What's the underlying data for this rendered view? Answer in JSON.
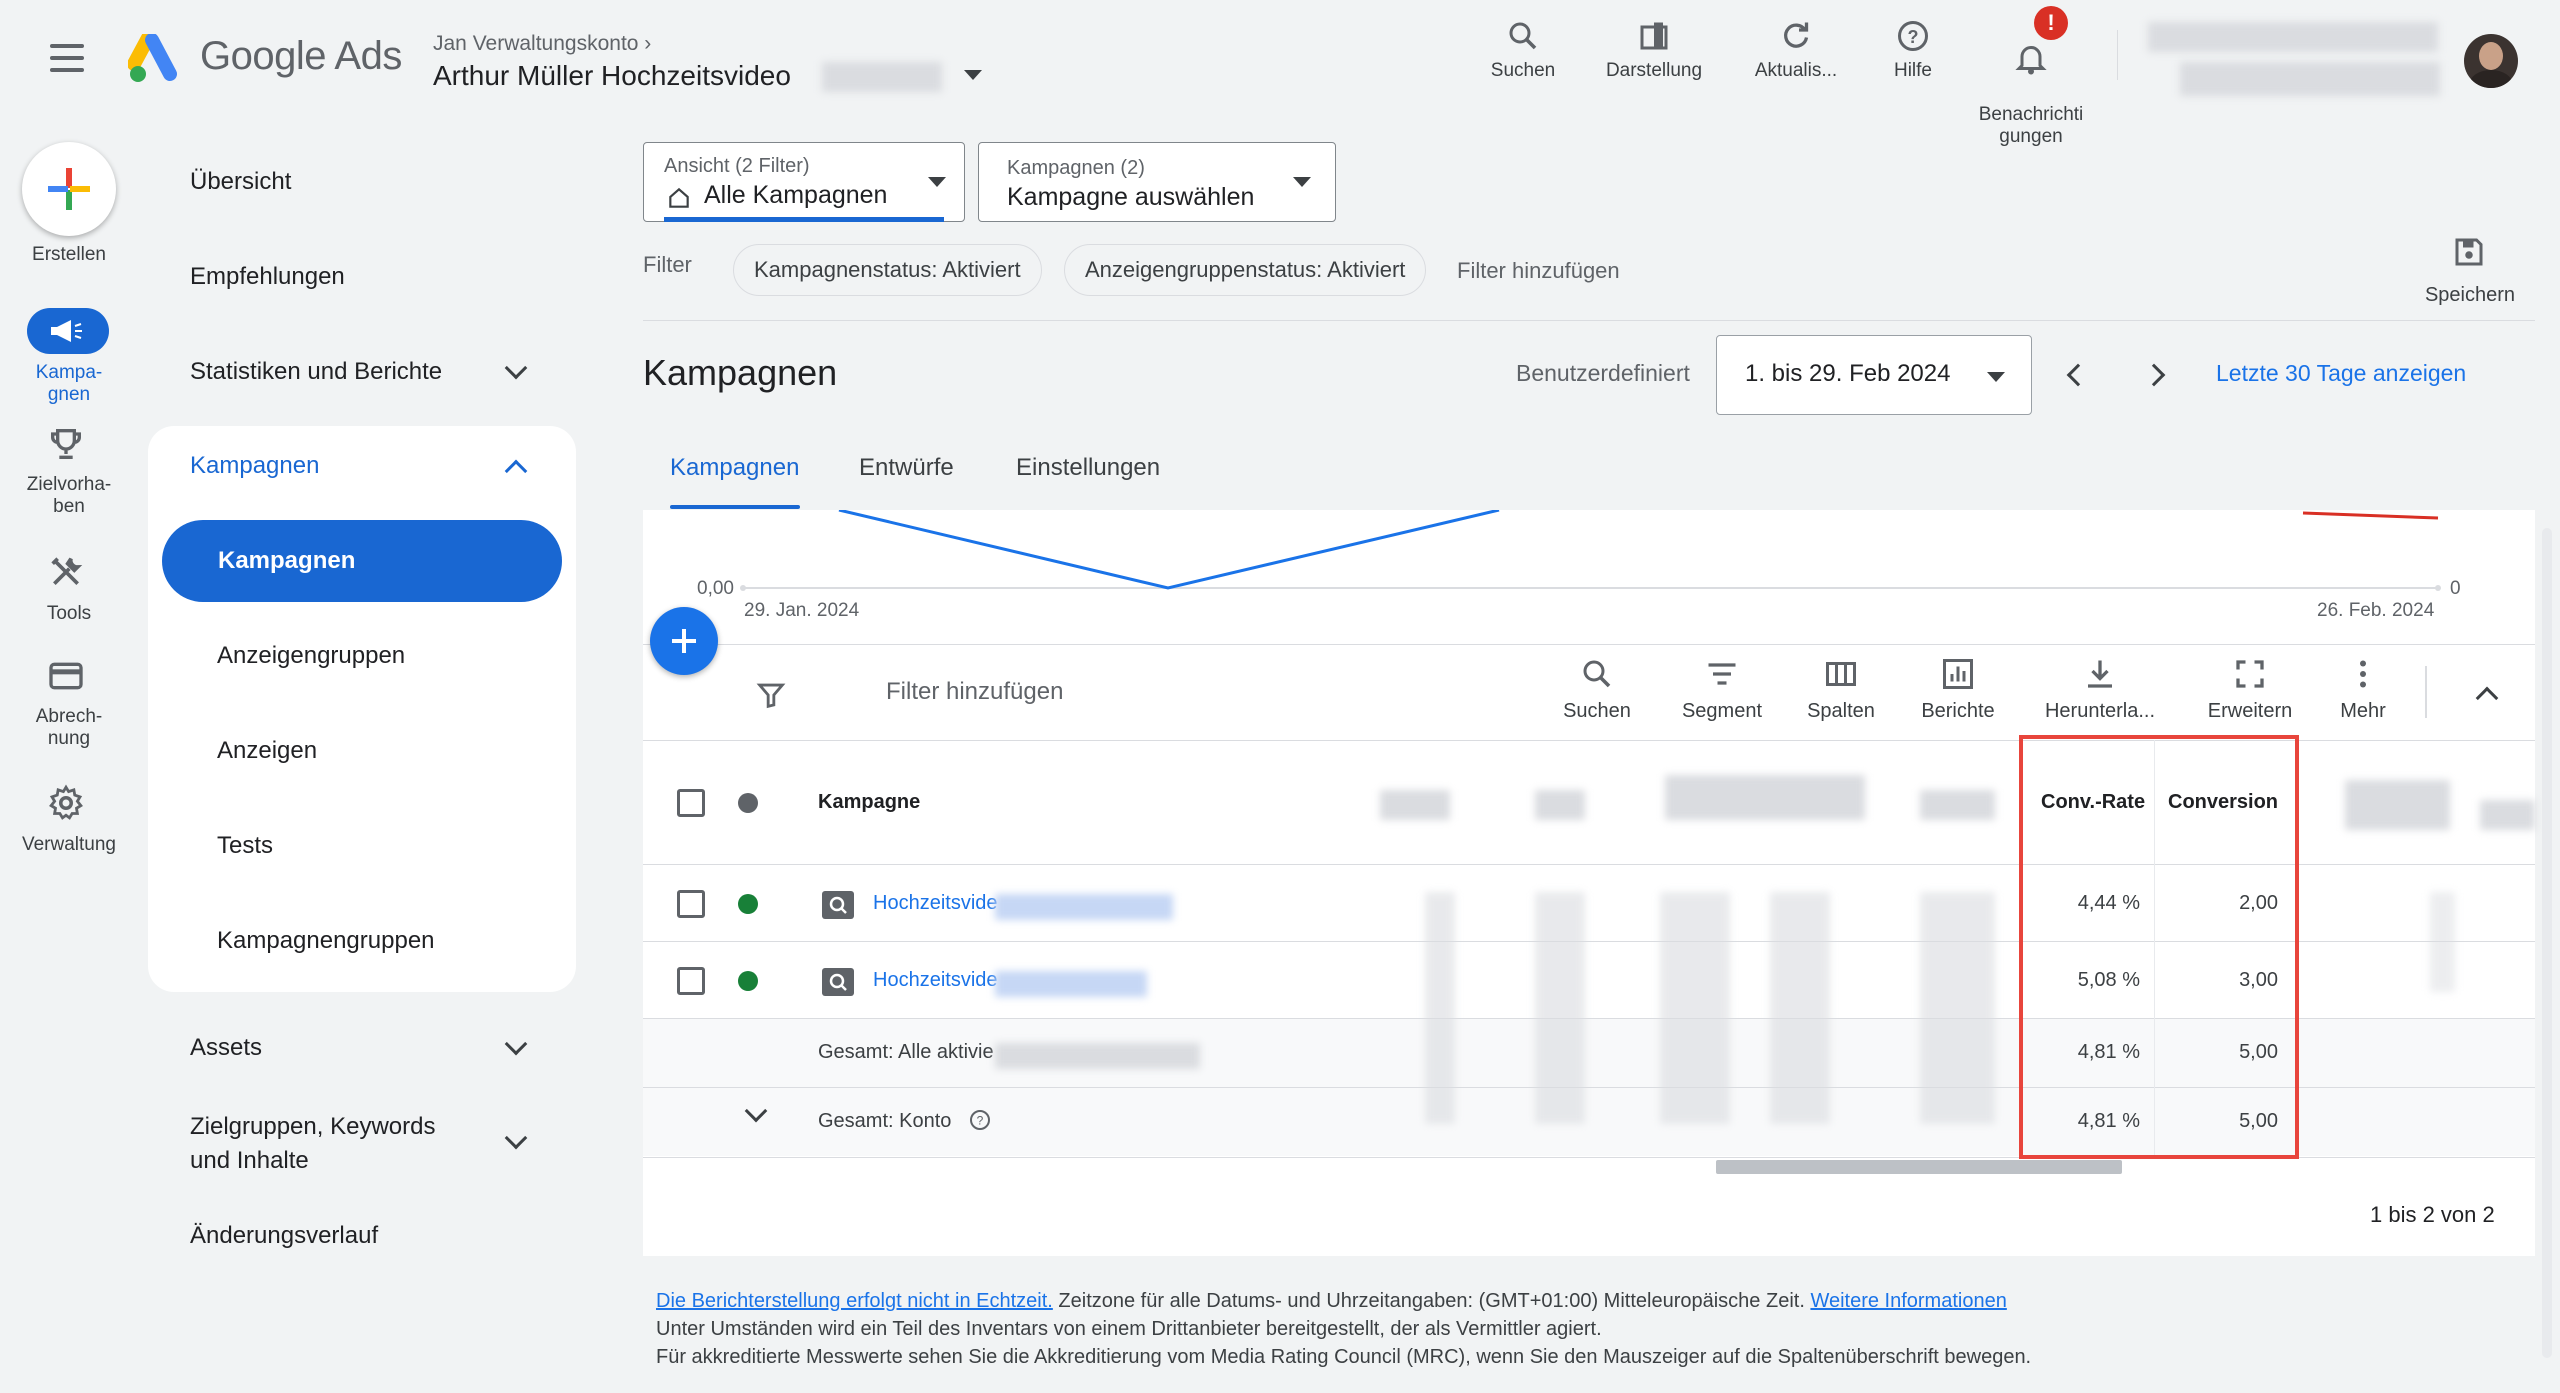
{
  "header": {
    "logo_text": "Google Ads",
    "account_parent": "Jan Verwaltungskonto",
    "account_name": "Arthur Müller Hochzeitsvideo",
    "toolbar": [
      {
        "label": "Suchen",
        "icon": "search-icon"
      },
      {
        "label": "Darstellung",
        "icon": "appearance-icon"
      },
      {
        "label": "Aktualis...",
        "icon": "refresh-icon"
      },
      {
        "label": "Hilfe",
        "icon": "help-icon"
      },
      {
        "label": "Benachrichti\ngungen",
        "icon": "bell-icon"
      }
    ],
    "notification_badge": "!"
  },
  "rail": {
    "create_label": "Erstellen",
    "items": [
      {
        "label": "Kampa-\ngnen",
        "icon": "megaphone-icon"
      },
      {
        "label": "Zielvorha-\nben",
        "icon": "trophy-icon"
      },
      {
        "label": "Tools",
        "icon": "tools-icon"
      },
      {
        "label": "Abrech-\nnung",
        "icon": "credit-card-icon"
      },
      {
        "label": "Verwaltung",
        "icon": "gear-icon"
      }
    ]
  },
  "nav": {
    "overview": "Übersicht",
    "recommendations": "Empfehlungen",
    "stats": "Statistiken und Berichte",
    "campaigns_section": "Kampagnen",
    "sub": [
      "Kampagnen",
      "Anzeigengruppen",
      "Anzeigen",
      "Tests",
      "Kampagnengruppen"
    ],
    "assets": "Assets",
    "audiences": "Zielgruppen, Keywords\nund Inhalte",
    "changes": "Änderungsverlauf"
  },
  "filters": {
    "view_label": "Ansicht (2 Filter)",
    "view_value": "Alle Kampagnen",
    "campaigns_label": "Kampagnen (2)",
    "campaigns_value": "Kampagne auswählen",
    "filter_label": "Filter",
    "chips": [
      "Kampagnenstatus: Aktiviert",
      "Anzeigengruppenstatus: Aktiviert"
    ],
    "add_filter": "Filter hinzufügen",
    "save_label": "Speichern"
  },
  "page": {
    "title": "Kampagnen",
    "date_mode": "Benutzerdefiniert",
    "date_range": "1. bis 29. Feb 2024",
    "last_30": "Letzte 30 Tage anzeigen",
    "tabs": [
      "Kampagnen",
      "Entwürfe",
      "Einstellungen"
    ]
  },
  "chart": {
    "y_left": "0,00",
    "y_right": "0",
    "x_start": "29. Jan. 2024",
    "x_end": "26. Feb. 2024"
  },
  "table_toolbar": {
    "filter_placeholder": "Filter hinzufügen",
    "tools": [
      "Suchen",
      "Segment",
      "Spalten",
      "Berichte",
      "Herunterla...",
      "Erweitern",
      "Mehr"
    ]
  },
  "table": {
    "col_campaign": "Kampagne",
    "col_conv_rate": "Conv.-Rate",
    "col_conversions": "Conversions",
    "rows": [
      {
        "name": "Hochzeitsvide",
        "conv_rate": "4,44 %",
        "conversions": "2,00"
      },
      {
        "name": "Hochzeitsvide",
        "conv_rate": "5,08 %",
        "conversions": "3,00"
      }
    ],
    "total_active": {
      "label": "Gesamt: Alle aktivie",
      "conv_rate": "4,81 %",
      "conversions": "5,00"
    },
    "total_account": {
      "label": "Gesamt: Konto",
      "conv_rate": "4,81 %",
      "conversions": "5,00"
    },
    "pagination": "1 bis 2 von 2"
  },
  "footer": {
    "link1": "Die Berichterstellung erfolgt nicht in Echtzeit.",
    "text1": " Zeitzone für alle Datums- und Uhrzeitangaben: (GMT+01:00) Mitteleuropäische Zeit. ",
    "link2": "Weitere Informationen",
    "line2": "Unter Umständen wird ein Teil des Inventars von einem Drittanbieter bereitgestellt, der als Vermittler agiert.",
    "line3": "Für akkreditierte Messwerte sehen Sie die Akkreditierung vom Media Rating Council (MRC), wenn Sie den Mauszeiger auf die Spaltenüberschrift bewegen."
  },
  "colors": {
    "accent": "#1967d2",
    "highlight": "#e8453c",
    "enabled": "#188038"
  }
}
